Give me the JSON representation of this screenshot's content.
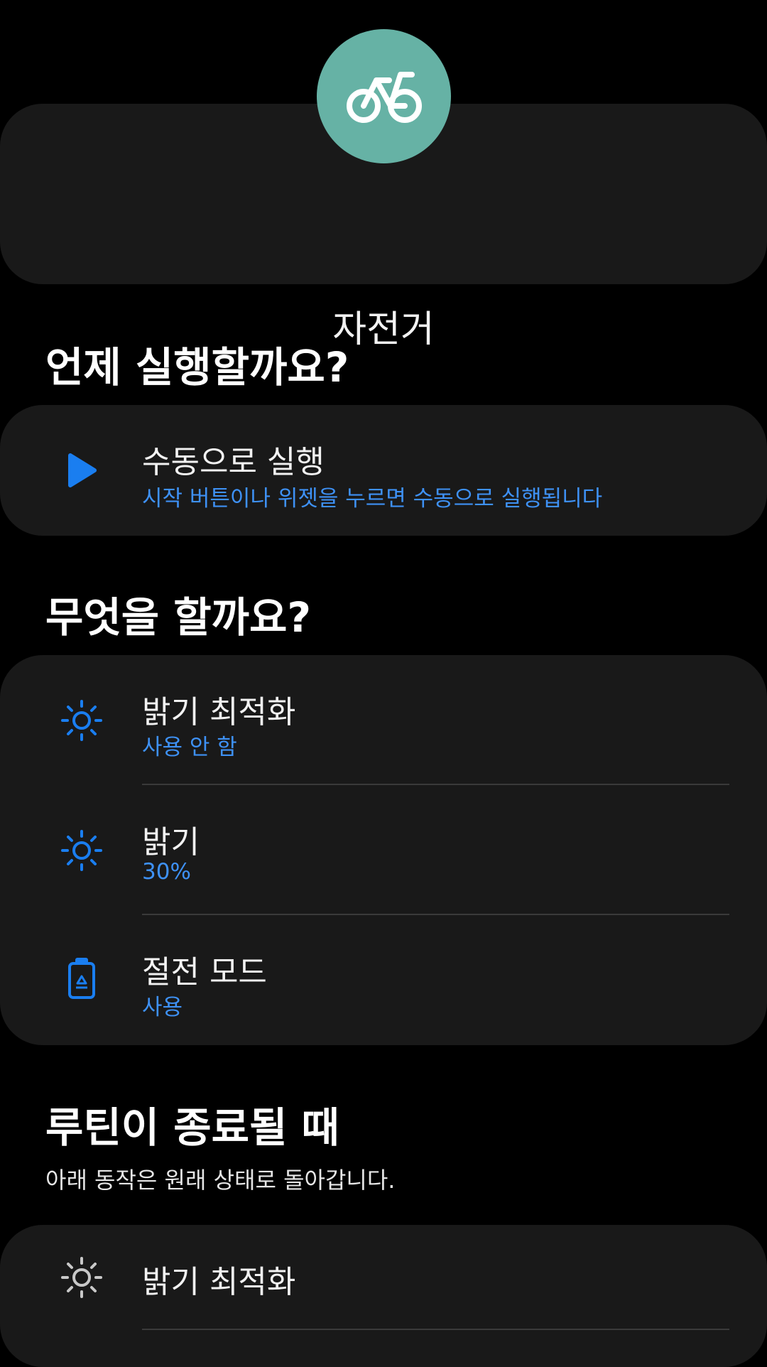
{
  "routine": {
    "name": "자전거",
    "icon": "bicycle-icon",
    "icon_bg_color": "#66b2a5"
  },
  "when_section": {
    "title": "언제 실행할까요?",
    "trigger": {
      "icon": "play-icon",
      "title": "수동으로 실행",
      "subtitle": "시작 버튼이나 위젯을 누르면 수동으로 실행됩니다"
    }
  },
  "what_section": {
    "title": "무엇을 할까요?",
    "actions": [
      {
        "icon": "adaptive-brightness-icon",
        "title": "밝기 최적화",
        "subtitle": "사용 안 함"
      },
      {
        "icon": "brightness-icon",
        "title": "밝기",
        "subtitle": "30%"
      },
      {
        "icon": "battery-saver-icon",
        "title": "절전 모드",
        "subtitle": "사용"
      }
    ]
  },
  "end_section": {
    "title": "루틴이 종료될 때",
    "description": "아래 동작은 원래 상태로 돌아갑니다.",
    "items": [
      {
        "icon": "adaptive-brightness-icon",
        "title": "밝기 최적화"
      }
    ]
  },
  "colors": {
    "accent": "#3e91f5",
    "card_bg": "#191919",
    "background": "#000000"
  }
}
